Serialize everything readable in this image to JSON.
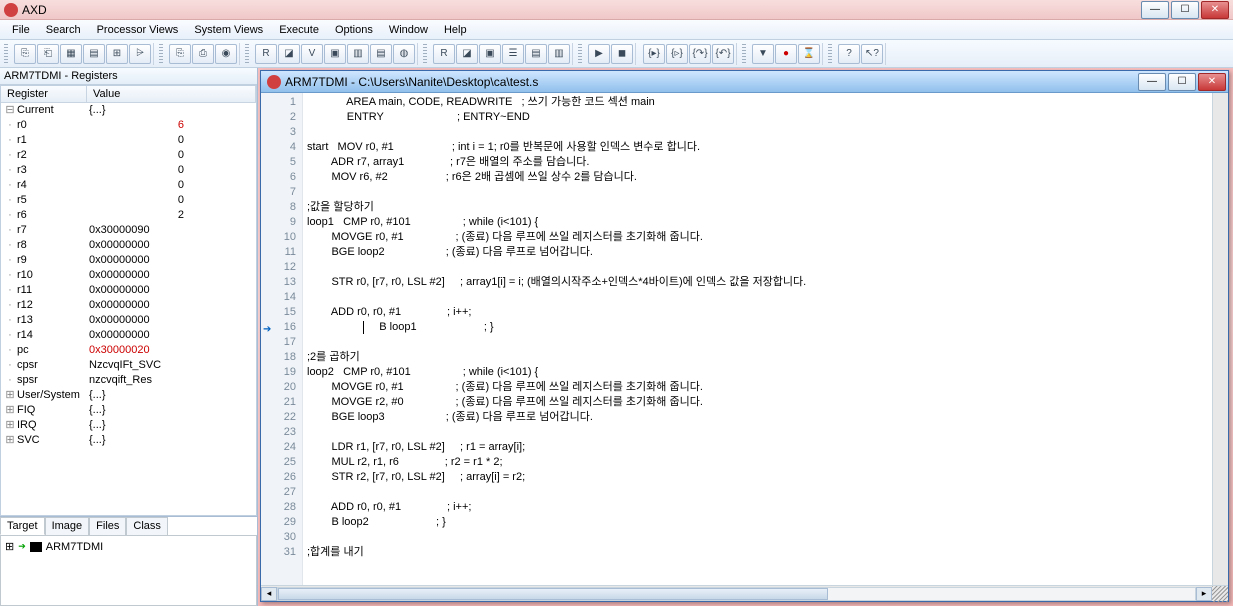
{
  "app": {
    "title": "AXD"
  },
  "menu": [
    "File",
    "Search",
    "Processor Views",
    "System Views",
    "Execute",
    "Options",
    "Window",
    "Help"
  ],
  "registers_panel": {
    "title": "ARM7TDMI - Registers",
    "header": {
      "c1": "Register",
      "c2": "Value"
    },
    "groups": {
      "current_label": "Current",
      "current_val": "{...}",
      "rows": [
        {
          "name": "r0",
          "val": "6",
          "red": true
        },
        {
          "name": "r1",
          "val": "0"
        },
        {
          "name": "r2",
          "val": "0"
        },
        {
          "name": "r3",
          "val": "0"
        },
        {
          "name": "r4",
          "val": "0"
        },
        {
          "name": "r5",
          "val": "0"
        },
        {
          "name": "r6",
          "val": "2"
        },
        {
          "name": "r7",
          "val": "0x30000090"
        },
        {
          "name": "r8",
          "val": "0x00000000"
        },
        {
          "name": "r9",
          "val": "0x00000000"
        },
        {
          "name": "r10",
          "val": "0x00000000"
        },
        {
          "name": "r11",
          "val": "0x00000000"
        },
        {
          "name": "r12",
          "val": "0x00000000"
        },
        {
          "name": "r13",
          "val": "0x00000000"
        },
        {
          "name": "r14",
          "val": "0x00000000"
        },
        {
          "name": "pc",
          "val": "0x30000020",
          "red": true
        },
        {
          "name": "cpsr",
          "val": "NzcvqIFt_SVC"
        },
        {
          "name": "spsr",
          "val": "nzcvqift_Res"
        }
      ],
      "tail": [
        {
          "name": "User/System",
          "val": "{...}"
        },
        {
          "name": "FIQ",
          "val": "{...}"
        },
        {
          "name": "IRQ",
          "val": "{...}"
        },
        {
          "name": "SVC",
          "val": "{...}"
        }
      ]
    }
  },
  "tabs": {
    "items": [
      "Target",
      "Image",
      "Files",
      "Class"
    ],
    "active": 0,
    "target_item": "ARM7TDMI"
  },
  "code": {
    "title": "ARM7TDMI - C:\\Users\\Nanite\\Desktop\\ca\\test.s",
    "current_line": 16,
    "lines": [
      "             AREA main, CODE, READWRITE   ; 쓰기 가능한 코드 섹션 main",
      "             ENTRY                        ; ENTRY~END",
      "",
      "start   MOV r0, #1                   ; int i = 1; r0를 반복문에 사용할 인덱스 변수로 합니다.",
      "        ADR r7, array1               ; r7은 배열의 주소를 담습니다.",
      "        MOV r6, #2                   ; r6은 2배 곱셈에 쓰일 상수 2를 담습니다.",
      "",
      ";값을 할당하기",
      "loop1   CMP r0, #101                 ; while (i<101) {",
      "        MOVGE r0, #1                 ; (종료) 다음 루프에 쓰일 레지스터를 초기화해 줍니다.",
      "        BGE loop2                    ; (종료) 다음 루프로 넘어갑니다.",
      "",
      "        STR r0, [r7, r0, LSL #2]     ; array1[i] = i; (배열의시작주소+인덱스*4바이트)에 인덱스 값을 저장합니다.",
      "",
      "        ADD r0, r0, #1               ; i++;",
      "        B loop1                      ; }",
      "",
      ";2를 곱하기",
      "loop2   CMP r0, #101                 ; while (i<101) {",
      "        MOVGE r0, #1                 ; (종료) 다음 루프에 쓰일 레지스터를 초기화해 줍니다.",
      "        MOVGE r2, #0                 ; (종료) 다음 루프에 쓰일 레지스터를 초기화해 줍니다.",
      "        BGE loop3                    ; (종료) 다음 루프로 넘어갑니다.",
      "",
      "        LDR r1, [r7, r0, LSL #2]     ; r1 = array[i];",
      "        MUL r2, r1, r6               ; r2 = r1 * 2;",
      "        STR r2, [r7, r0, LSL #2]     ; array[i] = r2;",
      "",
      "        ADD r0, r0, #1               ; i++;",
      "        B loop2                      ; }",
      "",
      ";합계를 내기"
    ]
  }
}
